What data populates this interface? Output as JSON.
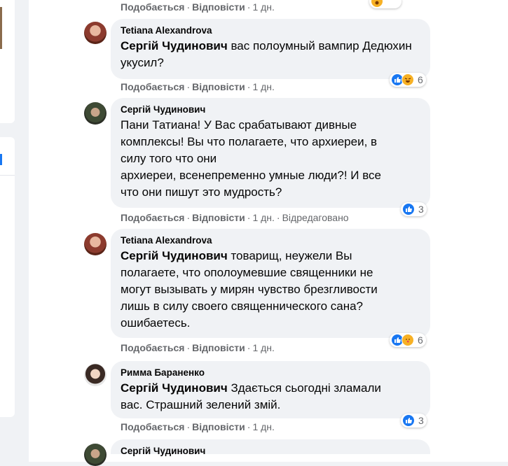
{
  "top_actions": {
    "like": "Подобається",
    "reply": "Відповісти",
    "time": "1 дн."
  },
  "comments": [
    {
      "author": "Tetiana Alexandrova",
      "mention": "Сергій Чудинович",
      "text": " вас полоумный вампир Дедюхин укусил?",
      "reactions": {
        "icons": [
          "like-icon",
          "haha-icon"
        ],
        "count": "6"
      },
      "actions": {
        "like": "Подобається",
        "reply": "Відповісти",
        "time": "1 дн."
      }
    },
    {
      "author": "Сергій Чудинович",
      "text_lines": [
        "Пани Татиана! У Вас срабатывают дивные",
        "комплексы! Вы что полагаете, что архиереи, в",
        "силу того что они",
        "архиереи, всенепременно умные люди?! И все",
        "что они пишут это мудрость?"
      ],
      "reactions": {
        "icons": [
          "like-icon"
        ],
        "count": "3"
      },
      "actions": {
        "like": "Подобається",
        "reply": "Відповісти",
        "time": "1 дн.",
        "edited": "Відредаговано"
      }
    },
    {
      "author": "Tetiana Alexandrova",
      "mention": "Сергій Чудинович",
      "text_lines": [
        " товарищ, неужели Вы",
        "полагаете, что ополоумевшие священники не",
        "могут вызывать у мирян чувство брезгливости",
        "лишь в силу своего священнического сана?",
        "ошибаетесь."
      ],
      "reactions": {
        "icons": [
          "like-icon",
          "care-icon"
        ],
        "count": "6"
      },
      "actions": {
        "like": "Подобається",
        "reply": "Відповісти",
        "time": "1 дн."
      }
    },
    {
      "author": "Римма Бараненко",
      "mention": "Сергій Чудинович",
      "text_lines": [
        " Здається сьогодні зламали",
        "вас. Страшний зелений змій."
      ],
      "reactions": {
        "icons": [
          "like-icon"
        ],
        "count": "3"
      },
      "actions": {
        "like": "Подобається",
        "reply": "Відповісти",
        "time": "1 дн."
      }
    },
    {
      "author": "Сергій Чудинович"
    }
  ],
  "colors": {
    "bubble": "#f0f2f5",
    "meta_text": "#65676b",
    "like_blue": "#1877f2",
    "emoji_yellow": "#f7b125"
  }
}
